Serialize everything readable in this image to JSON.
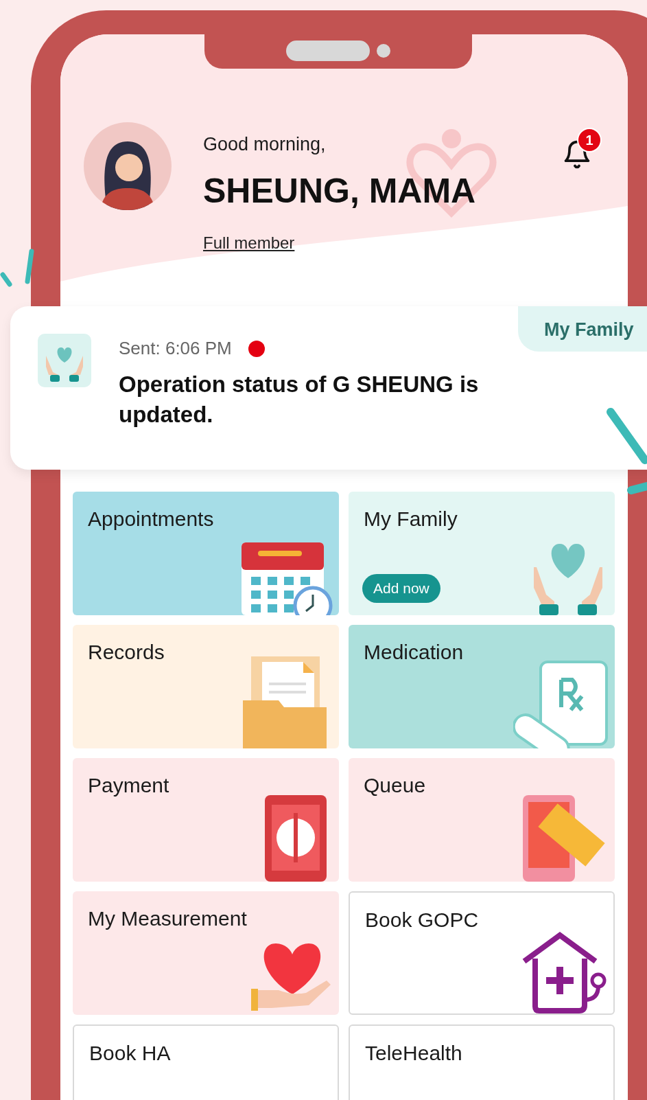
{
  "greeting": "Good morning,",
  "name": "SHEUNG, MAMA",
  "membership": "Full member",
  "notifications": {
    "badge": "1"
  },
  "message": {
    "tab": "My Family",
    "sent": "Sent: 6:06 PM",
    "unread": true,
    "text": "Operation status of G SHEUNG is updated."
  },
  "tiles": [
    {
      "kind": "appointments",
      "label": "Appointments"
    },
    {
      "kind": "family",
      "label": "My Family",
      "action": "Add now"
    },
    {
      "kind": "records",
      "label": "Records"
    },
    {
      "kind": "medication",
      "label": "Medication"
    },
    {
      "kind": "payment",
      "label": "Payment"
    },
    {
      "kind": "queue",
      "label": "Queue"
    },
    {
      "kind": "measurement",
      "label": "My Measurement"
    },
    {
      "kind": "gopc",
      "label": "Book GOPC"
    },
    {
      "kind": "ha",
      "label": "Book HA"
    },
    {
      "kind": "telehealth",
      "label": "TeleHealth"
    }
  ]
}
